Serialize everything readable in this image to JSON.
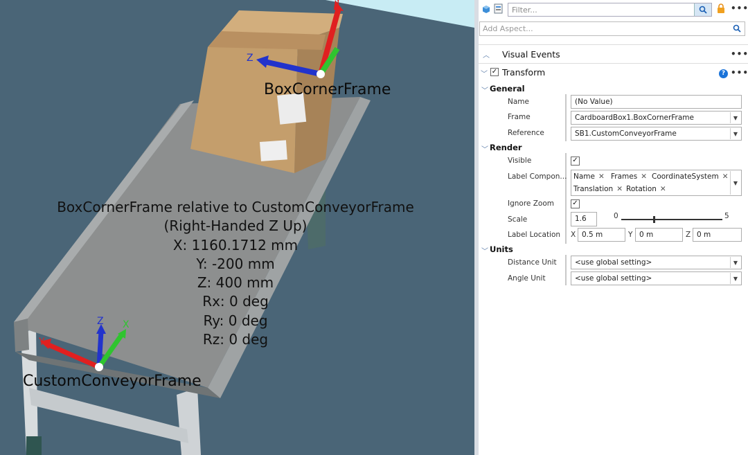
{
  "viewport": {
    "box_frame_label": "BoxCornerFrame",
    "conveyor_frame_label": "CustomConveyorFrame",
    "info_lines": [
      "BoxCornerFrame relative to CustomConveyorFrame",
      "(Right-Handed Z Up)",
      "X: 1160.1712 mm",
      "Y: -200 mm",
      "Z: 400 mm",
      "Rx: 0 deg",
      "Ry: 0 deg",
      "Rz: 0 deg"
    ],
    "axis_letters": {
      "x": "X",
      "y": "Y",
      "z": "Z"
    },
    "colors": {
      "x_axis": "#2fc42f",
      "y_axis": "#e02020",
      "z_axis": "#2233cc",
      "background": "#4a6577"
    }
  },
  "panel": {
    "filter_placeholder": "Filter...",
    "add_aspect_placeholder": "Add Aspect...",
    "visual_events_title": "Visual Events",
    "transform_title": "Transform",
    "more_label": "•••",
    "help_label": "?",
    "general": {
      "title": "General",
      "name_label": "Name",
      "name_value": "(No Value)",
      "frame_label": "Frame",
      "frame_value": "CardboardBox1.BoxCornerFrame",
      "reference_label": "Reference",
      "reference_value": "SB1.CustomConveyorFrame"
    },
    "render": {
      "title": "Render",
      "visible_label": "Visible",
      "label_components_label": "Label Compon...",
      "label_components": [
        "Name",
        "Frames",
        "CoordinateSystem",
        "Translation",
        "Rotation"
      ],
      "remove_symbol": "✕",
      "ignore_zoom_label": "Ignore Zoom",
      "scale_label": "Scale",
      "scale_value": "1.6",
      "scale_min": "0",
      "scale_max": "5",
      "scale_fraction": 0.32,
      "label_location_label": "Label Location",
      "loc_x_label": "X",
      "loc_x_value": "0.5 m",
      "loc_y_label": "Y",
      "loc_y_value": "0 m",
      "loc_z_label": "Z",
      "loc_z_value": "0 m"
    },
    "units": {
      "title": "Units",
      "distance_label": "Distance Unit",
      "distance_value": "<use global setting>",
      "angle_label": "Angle Unit",
      "angle_value": "<use global setting>"
    }
  }
}
